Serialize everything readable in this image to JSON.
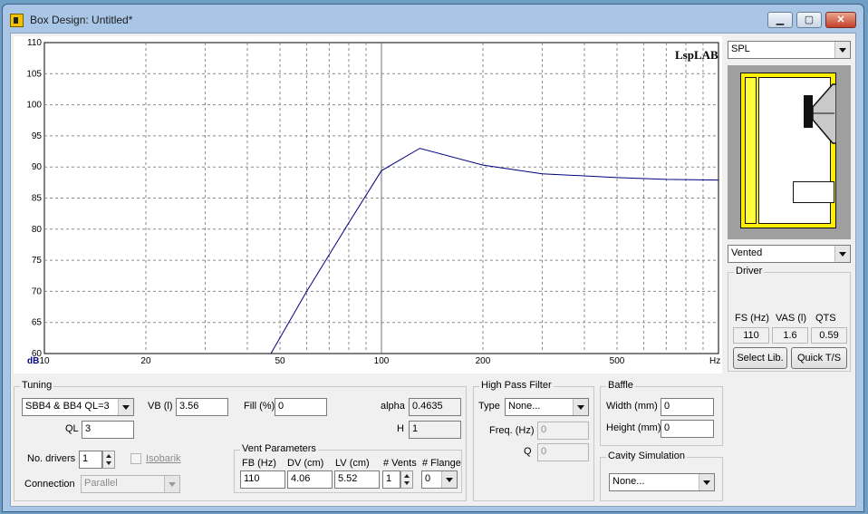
{
  "window": {
    "title": "Box Design: Untitled*",
    "minimize_glyph": "▁",
    "maximize_glyph": "▢",
    "close_glyph": "✕"
  },
  "chart_data": {
    "type": "line",
    "brand": "LspLAB",
    "ylabel": "dB",
    "xlabel": "Hz",
    "y_ticks": [
      60,
      65,
      70,
      75,
      80,
      85,
      90,
      95,
      100,
      105,
      110
    ],
    "x_ticks": [
      10,
      20,
      50,
      100,
      200,
      500
    ],
    "ylim": [
      60,
      110
    ],
    "xlim": [
      10,
      1000
    ],
    "x_scale": "log",
    "grid": true,
    "marker_x": 100,
    "series": [
      {
        "values": [
          [
            47,
            60
          ],
          [
            60,
            70
          ],
          [
            80,
            81
          ],
          [
            100,
            89.4
          ],
          [
            130,
            93
          ],
          [
            200,
            90.3
          ],
          [
            300,
            88.9
          ],
          [
            500,
            88.3
          ],
          [
            700,
            88
          ],
          [
            1000,
            87.9
          ]
        ]
      }
    ],
    "colors": {
      "line": "#000080",
      "marker": "#707070",
      "grid": "#8a8a8a"
    }
  },
  "right_panel": {
    "graph_select": "SPL",
    "box_type": "Vented",
    "driver_group": "Driver",
    "fs_label": "FS (Hz)",
    "vas_label": "VAS (l)",
    "qts_label": "QTS",
    "fs": "110",
    "vas": "1.6",
    "qts": "0.59",
    "select_lib": "Select Lib.",
    "quick_ts": "Quick T/S"
  },
  "tuning": {
    "group": "Tuning",
    "alignment": "SBB4 & BB4 QL=3",
    "vb_label": "VB (l)",
    "vb": "3.56",
    "fill_label": "Fill (%)",
    "fill": "0",
    "alpha_label": "alpha",
    "alpha": "0.4635",
    "ql_label": "QL",
    "ql": "3",
    "h_label": "H",
    "h": "1",
    "drivers_label": "No. drivers",
    "drivers": "1",
    "isobarik_label": "Isobarik",
    "connection_label": "Connection",
    "connection": "Parallel"
  },
  "vent": {
    "group": "Vent Parameters",
    "fb_label": "FB (Hz)",
    "fb": "110",
    "dv_label": "DV (cm)",
    "dv": "4.06",
    "lv_label": "LV (cm)",
    "lv": "5.52",
    "vents_label": "# Vents",
    "vents": "1",
    "flange_label": "# Flange",
    "flange": "0"
  },
  "hpf": {
    "group": "High Pass Filter",
    "type_label": "Type",
    "type": "None...",
    "freq_label": "Freq. (Hz)",
    "freq": "0",
    "q_label": "Q",
    "q": "0"
  },
  "baffle": {
    "group": "Baffle",
    "width_label": "Width (mm)",
    "width": "0",
    "height_label": "Height (mm)",
    "height": "0"
  },
  "cavity": {
    "group": "Cavity Simulation",
    "value": "None..."
  }
}
